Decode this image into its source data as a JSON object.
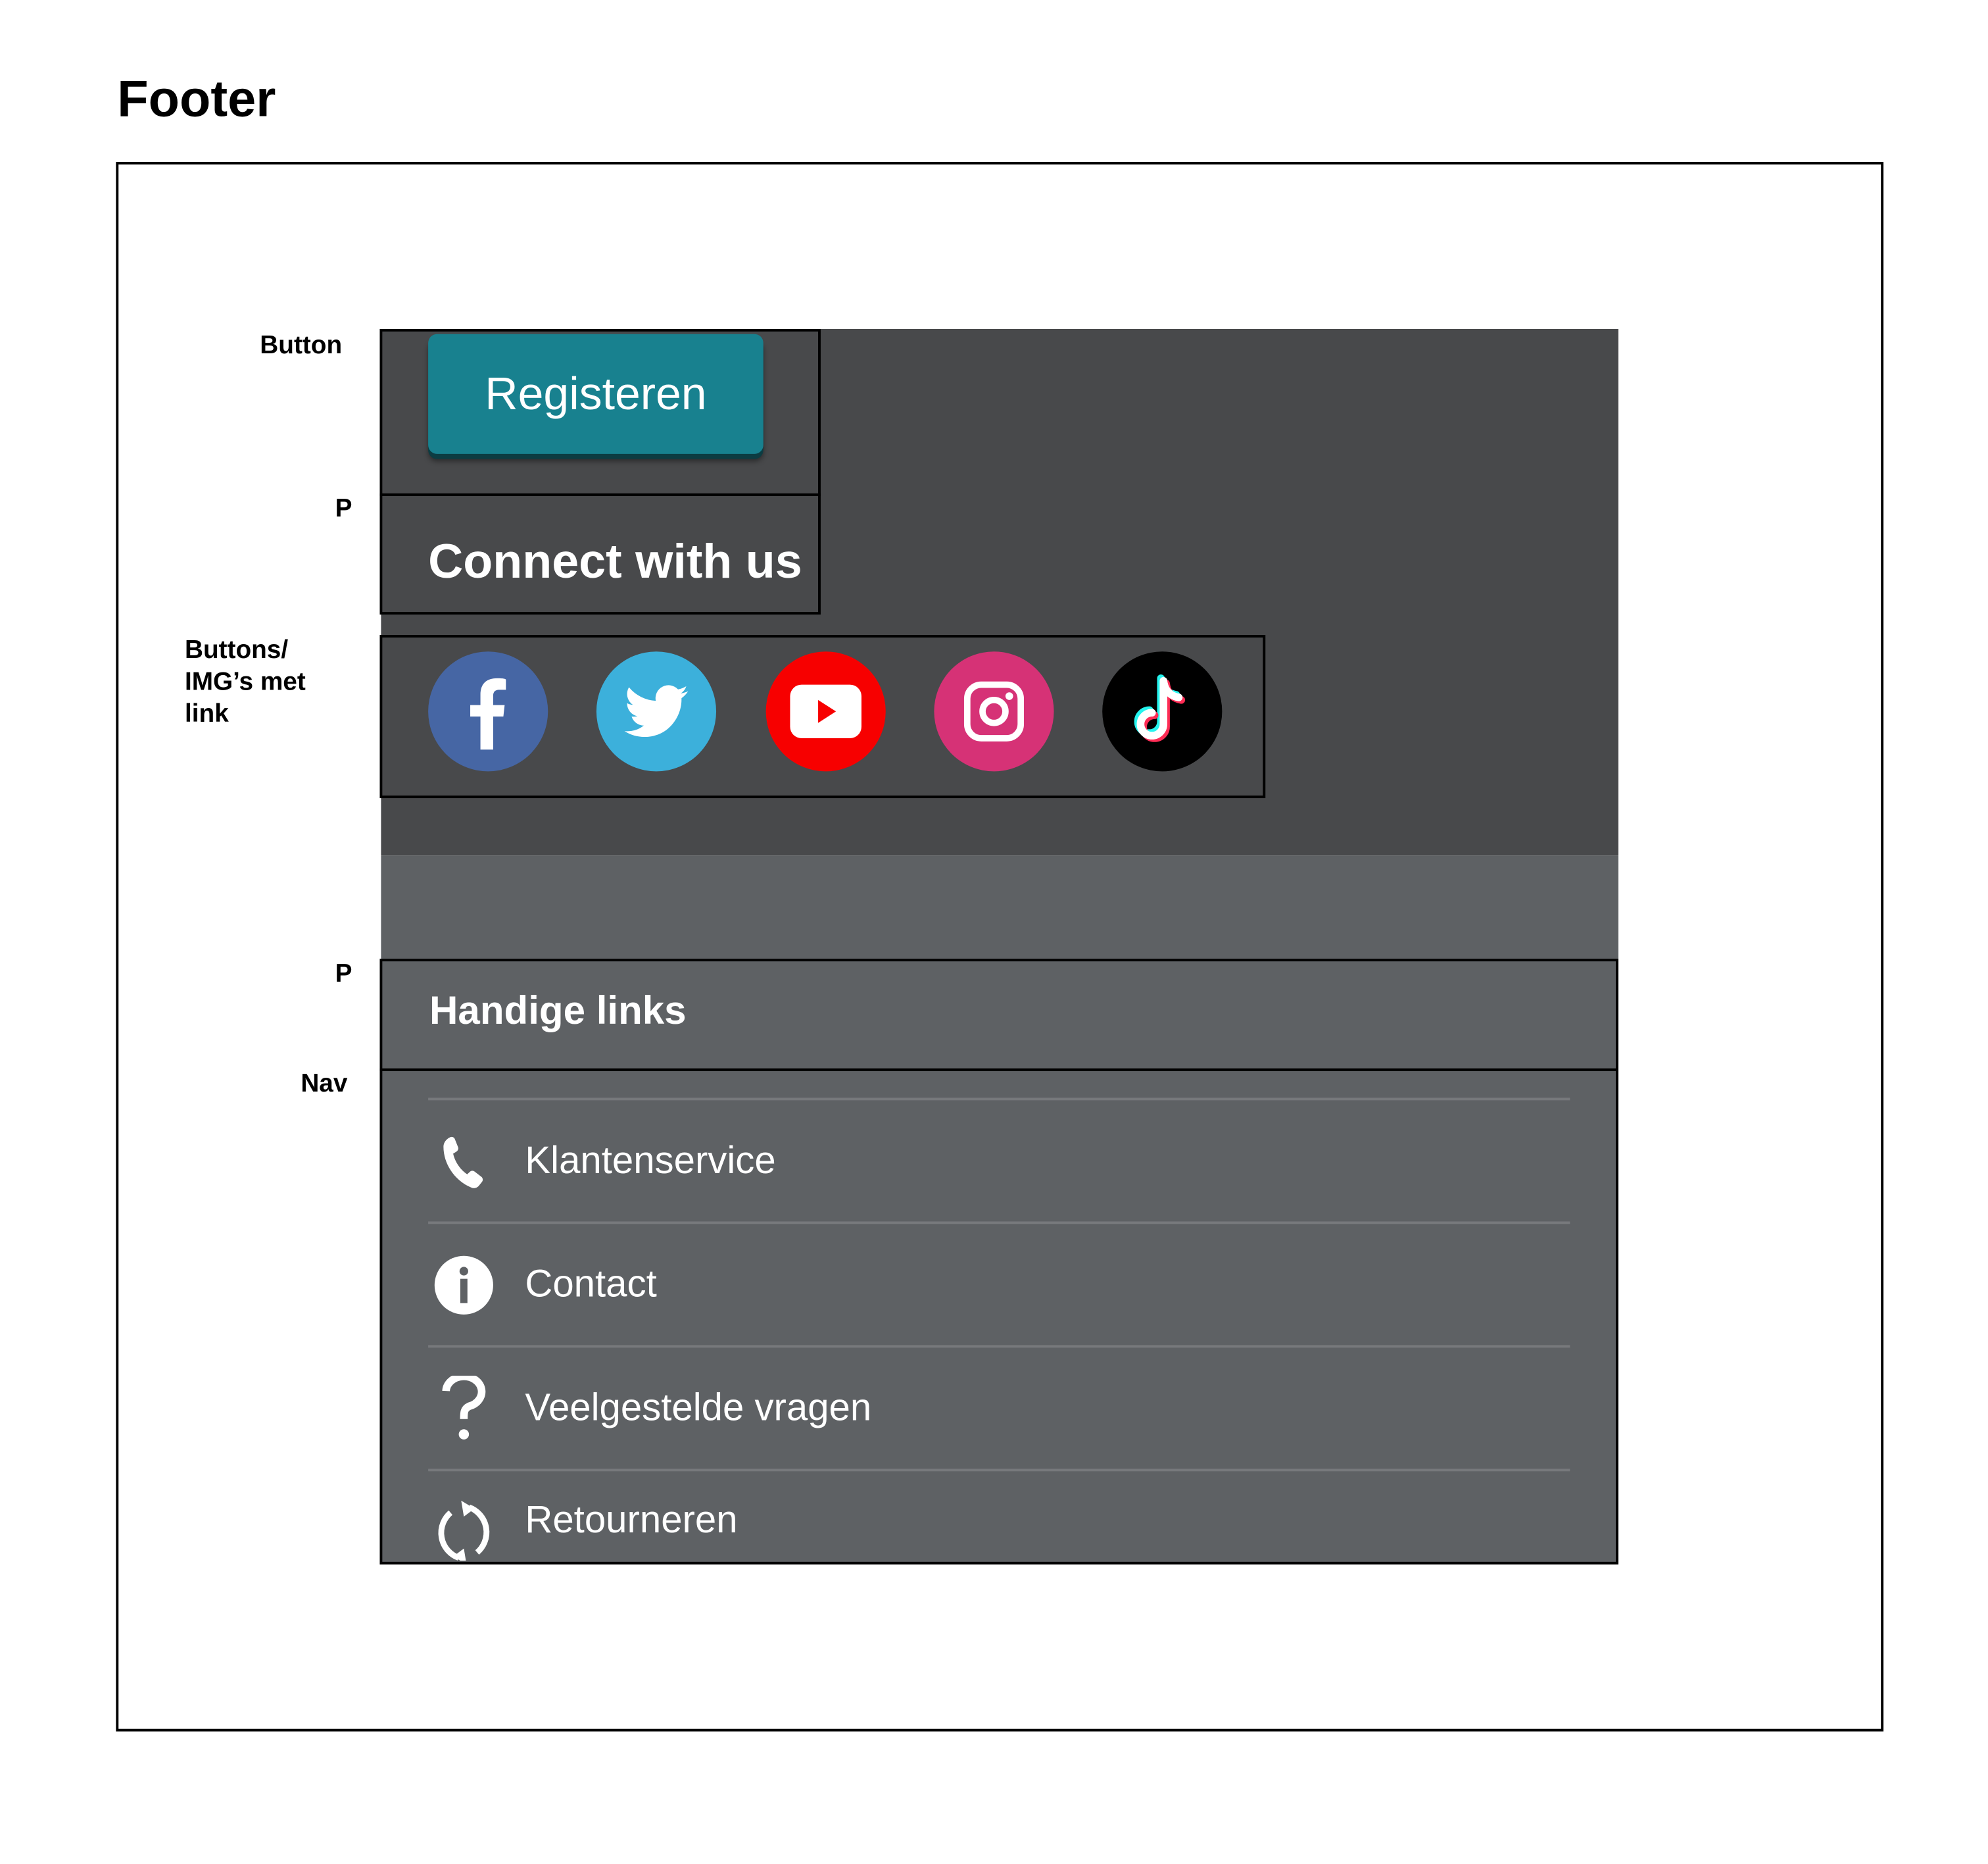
{
  "page_title": "Footer",
  "annotations": {
    "button": "Button",
    "p1": "P",
    "buttons_imgs": [
      "Buttons/",
      "IMG’s met",
      "link"
    ],
    "p2": "P",
    "nav": "Nav"
  },
  "footer": {
    "register_button": "Registeren",
    "connect_heading": "Connect with us",
    "social": [
      {
        "name": "facebook",
        "color": "#4666a4"
      },
      {
        "name": "twitter",
        "color": "#3cb0db"
      },
      {
        "name": "youtube",
        "color": "#f70000"
      },
      {
        "name": "instagram",
        "color": "#d63276"
      },
      {
        "name": "tiktok",
        "color": "#000000"
      }
    ],
    "links_heading": "Handige links",
    "nav": [
      {
        "label": "Klantenservice",
        "icon": "phone-icon"
      },
      {
        "label": "Contact",
        "icon": "info-icon"
      },
      {
        "label": "Veelgestelde vragen",
        "icon": "question-icon"
      },
      {
        "label": "Retourneren",
        "icon": "refresh-icon"
      }
    ],
    "colors": {
      "accent": "#18818f",
      "dark_bg": "#48494b",
      "light_bg": "#5e6164"
    }
  }
}
